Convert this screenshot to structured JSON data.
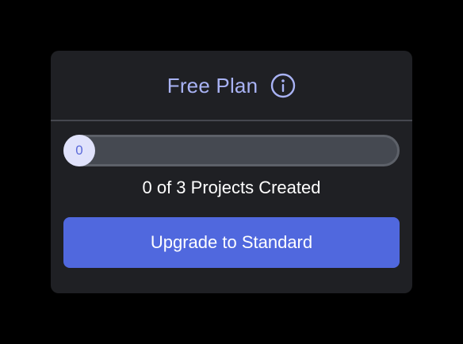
{
  "plan": {
    "title": "Free Plan",
    "info_icon": "info-circle-icon"
  },
  "progress": {
    "current": 0,
    "max": 3,
    "knob_label": "0",
    "status_text": "0 of 3 Projects Created"
  },
  "actions": {
    "upgrade_label": "Upgrade to Standard"
  },
  "colors": {
    "accent": "#5068de",
    "title": "#a9b3f5",
    "card_bg": "#1f2024",
    "page_bg": "#000000"
  }
}
